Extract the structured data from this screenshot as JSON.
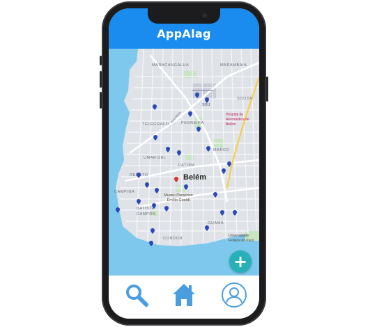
{
  "app": {
    "title": "AppAlag"
  },
  "map": {
    "city_label": "Belém",
    "neighborhoods": [
      "MARACANGALHA",
      "MARAMBAIA",
      "SOUZA",
      "TELÉGRAFO",
      "PEDREIRA",
      "UMARIZAL",
      "FÁTIMA",
      "MARCO",
      "REDUTO",
      "CAMPINA",
      "BATISTA CAMPOS",
      "GUAMÁ",
      "CONDOR"
    ],
    "poi_airport": "SBJ",
    "poi_hospital": "Hospital de Aeronáutica de Belém",
    "poi_museum": "Museu Paraense Emílio Goeldi",
    "poi_university": "Universidade Federal do Pará",
    "street_label": "Rua Nova",
    "water_color": "#7dc8ec",
    "pin_color": "#2a48b8"
  },
  "fab": {
    "icon": "plus-icon",
    "label": "+"
  },
  "bottom_nav": {
    "items": [
      {
        "name": "search",
        "icon": "search-icon"
      },
      {
        "name": "home",
        "icon": "home-icon"
      },
      {
        "name": "profile",
        "icon": "user-icon"
      }
    ]
  }
}
